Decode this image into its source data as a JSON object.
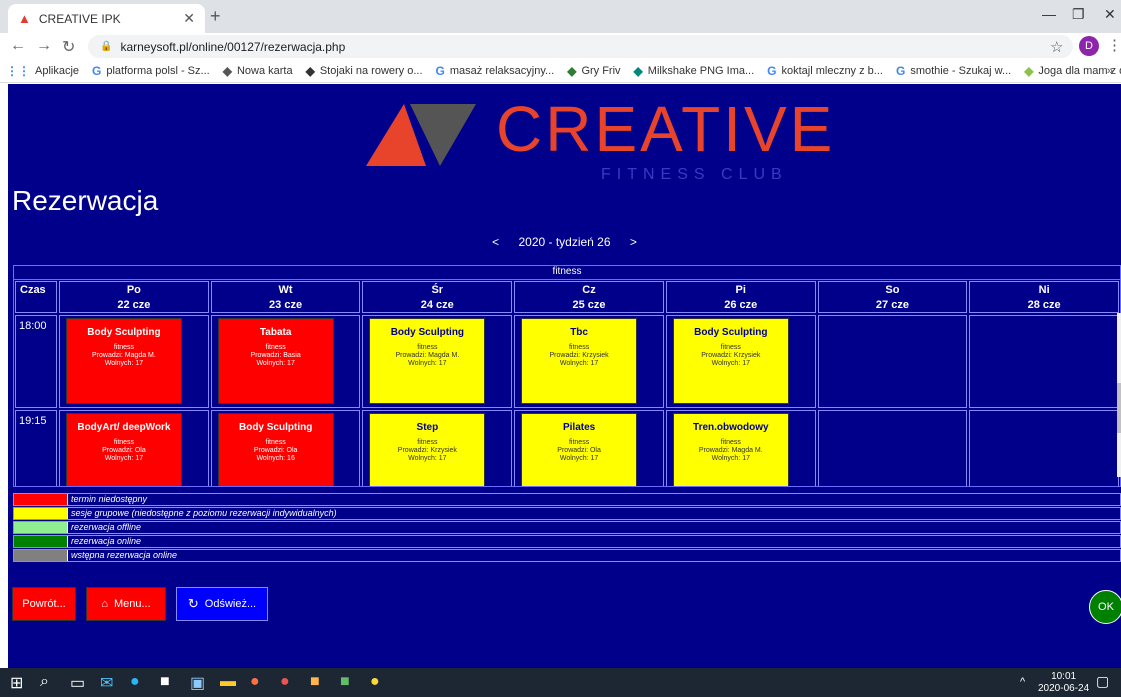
{
  "browser": {
    "tab_title": "CREATIVE IPK",
    "url": "karneysoft.pl/online/00127/rezerwacja.php",
    "avatar_letter": "D",
    "bookmarks": [
      {
        "label": "Aplikacje",
        "icon": "apps-grid-icon",
        "color": "#4285f4"
      },
      {
        "label": "platforma polsl - Sz...",
        "icon": "google-icon",
        "color": "#4285f4"
      },
      {
        "label": "Nowa karta",
        "icon": "globe-icon",
        "color": "#555555"
      },
      {
        "label": "Stojaki na rowery o...",
        "icon": "pencil-icon",
        "color": "#333333"
      },
      {
        "label": "masaż relaksacyjny...",
        "icon": "google-icon",
        "color": "#4285f4"
      },
      {
        "label": "Gry Friv",
        "icon": "game-icon",
        "color": "#2e7d32"
      },
      {
        "label": "Milkshake PNG Ima...",
        "icon": "image-icon",
        "color": "#00897b"
      },
      {
        "label": "koktajl mleczny z b...",
        "icon": "google-icon",
        "color": "#4285f4"
      },
      {
        "label": "smothie - Szukaj w...",
        "icon": "google-icon",
        "color": "#4285f4"
      },
      {
        "label": "Joga dla mam z dzi...",
        "icon": "video-icon",
        "color": "#8bc34a"
      }
    ]
  },
  "page": {
    "logo_word": "CREATIVE",
    "logo_sub": "FITNESS CLUB",
    "heading": "Rezerwacja",
    "week_prev": "<",
    "week_label": "2020 - tydzień 26",
    "week_next": ">"
  },
  "schedule": {
    "category": "fitness",
    "time_header": "Czas",
    "days": [
      {
        "name": "Po",
        "date": "22 cze"
      },
      {
        "name": "Wt",
        "date": "23 cze"
      },
      {
        "name": "Śr",
        "date": "24 cze"
      },
      {
        "name": "Cz",
        "date": "25 cze"
      },
      {
        "name": "Pi",
        "date": "26 cze"
      },
      {
        "name": "So",
        "date": "27 cze"
      },
      {
        "name": "Ni",
        "date": "28 cze"
      }
    ],
    "rows": [
      {
        "time": "18:00",
        "events": [
          {
            "name": "Body Sculpting",
            "cat": "fitness",
            "instructor": "Prowadzi:  Magda M.",
            "free": "Wolnych: 17",
            "status": "red"
          },
          {
            "name": "Tabata",
            "cat": "fitness",
            "instructor": "Prowadzi:  Basia",
            "free": "Wolnych: 17",
            "status": "red"
          },
          {
            "name": "Body Sculpting",
            "cat": "fitness",
            "instructor": "Prowadzi:  Magda M.",
            "free": "Wolnych: 17",
            "status": "yellow"
          },
          {
            "name": "Tbc",
            "cat": "fitness",
            "instructor": "Prowadzi:  Krzysiek",
            "free": "Wolnych: 17",
            "status": "yellow"
          },
          {
            "name": "Body Sculpting",
            "cat": "fitness",
            "instructor": "Prowadzi:  Krzysiek",
            "free": "Wolnych: 17",
            "status": "yellow"
          }
        ]
      },
      {
        "time": "19:15",
        "events": [
          {
            "name": "BodyArt/ deepWork",
            "cat": "fitness",
            "instructor": "Prowadzi:  Ola",
            "free": "Wolnych: 17",
            "status": "red"
          },
          {
            "name": "Body Sculpting",
            "cat": "fitness",
            "instructor": "Prowadzi:  Ola",
            "free": "Wolnych: 16",
            "status": "red"
          },
          {
            "name": "Step",
            "cat": "fitness",
            "instructor": "Prowadzi:  Krzysiek",
            "free": "Wolnych: 17",
            "status": "yellow"
          },
          {
            "name": "Pilates",
            "cat": "fitness",
            "instructor": "Prowadzi:  Ola",
            "free": "Wolnych: 17",
            "status": "yellow"
          },
          {
            "name": "Tren.obwodowy",
            "cat": "fitness",
            "instructor": "Prowadzi:  Magda M.",
            "free": "Wolnych: 17",
            "status": "yellow"
          }
        ]
      }
    ]
  },
  "legend": [
    {
      "color": "#ff0000",
      "text": "termin niedostępny"
    },
    {
      "color": "#ffff00",
      "text": "sesje grupowe (niedostępne z poziomu rezerwacji indywidualnych)"
    },
    {
      "color": "#90ee90",
      "text": "rezerwacja offline"
    },
    {
      "color": "#008000",
      "text": "rezerwacja online"
    },
    {
      "color": "#808080",
      "text": "wstępna rezerwacja online"
    }
  ],
  "buttons": {
    "back": "Powrót...",
    "menu": "Menu...",
    "refresh": "Odśwież...",
    "ok": "OK"
  },
  "taskbar": {
    "time": "10:01",
    "date": "2020-06-24"
  }
}
